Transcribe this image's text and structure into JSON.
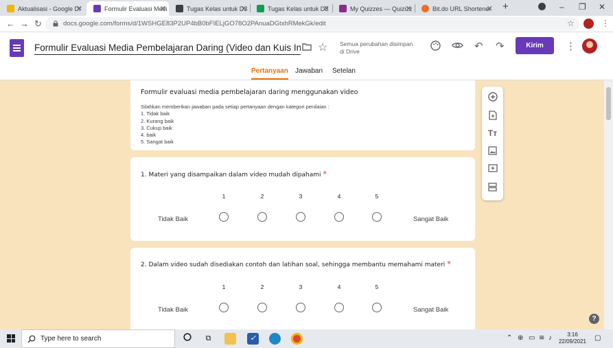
{
  "browser": {
    "tabs": [
      {
        "title": "Aktualisasi - Google Dr",
        "color": "#f4b400"
      },
      {
        "title": "Formulir Evaluasi Medi",
        "color": "#673ab7"
      },
      {
        "title": "Tugas Kelas untuk D3",
        "color": "#3c4043"
      },
      {
        "title": "Tugas Kelas untuk D3",
        "color": "#0f9d58"
      },
      {
        "title": "My Quizzes — Quizizz",
        "color": "#8e2b8a"
      },
      {
        "title": "Bit.do URL Shortener",
        "color": "#ee6c25"
      }
    ],
    "new_tab": "+",
    "window_controls": {
      "minimize": "–",
      "restore": "❐",
      "close": "✕"
    },
    "url": "docs.google.com/forms/d/1WSHGE83P2UP4bB0bFIELjGO78O2PAnuaDGtxhRMekGk/edit"
  },
  "form_header": {
    "title": "Formulir Evaluasi Media Pembelajaran Daring (Video dan Kuis Interaktif) C",
    "save_status": "Semua perubahan disimpan di Drive",
    "send_label": "Kirim"
  },
  "form_tabs": [
    "Pertanyaan",
    "Jawaban",
    "Setelan"
  ],
  "description": {
    "title": "Formulir evaluasi media pembelajaran daring menggunakan video",
    "intro": "Silahkan memberikan jawaban pada setiap pertanyaan dengan kategori penilaian :",
    "items": [
      "1.    Tidak baik",
      "2.    Kurang baik",
      "3.    Cukup baik",
      "4.    baik",
      "5.    Sangat baik"
    ]
  },
  "questions": [
    {
      "text": "1.    Materi yang disampaikan dalam video mudah dipahami",
      "required": "*",
      "scale": [
        "1",
        "2",
        "3",
        "4",
        "5"
      ],
      "low_label": "Tidak Baik",
      "high_label": "Sangat Baik"
    },
    {
      "text": "2.    Dalam video sudah disediakan contoh dan latihan soal, sehingga membantu memahami materi",
      "required": "*",
      "scale": [
        "1",
        "2",
        "3",
        "4",
        "5"
      ],
      "low_label": "Tidak Baik",
      "high_label": "Sangat Baik"
    }
  ],
  "taskbar": {
    "search_placeholder": "Type here to search",
    "time": "3:16",
    "date": "22/09/2021"
  },
  "help_label": "?"
}
